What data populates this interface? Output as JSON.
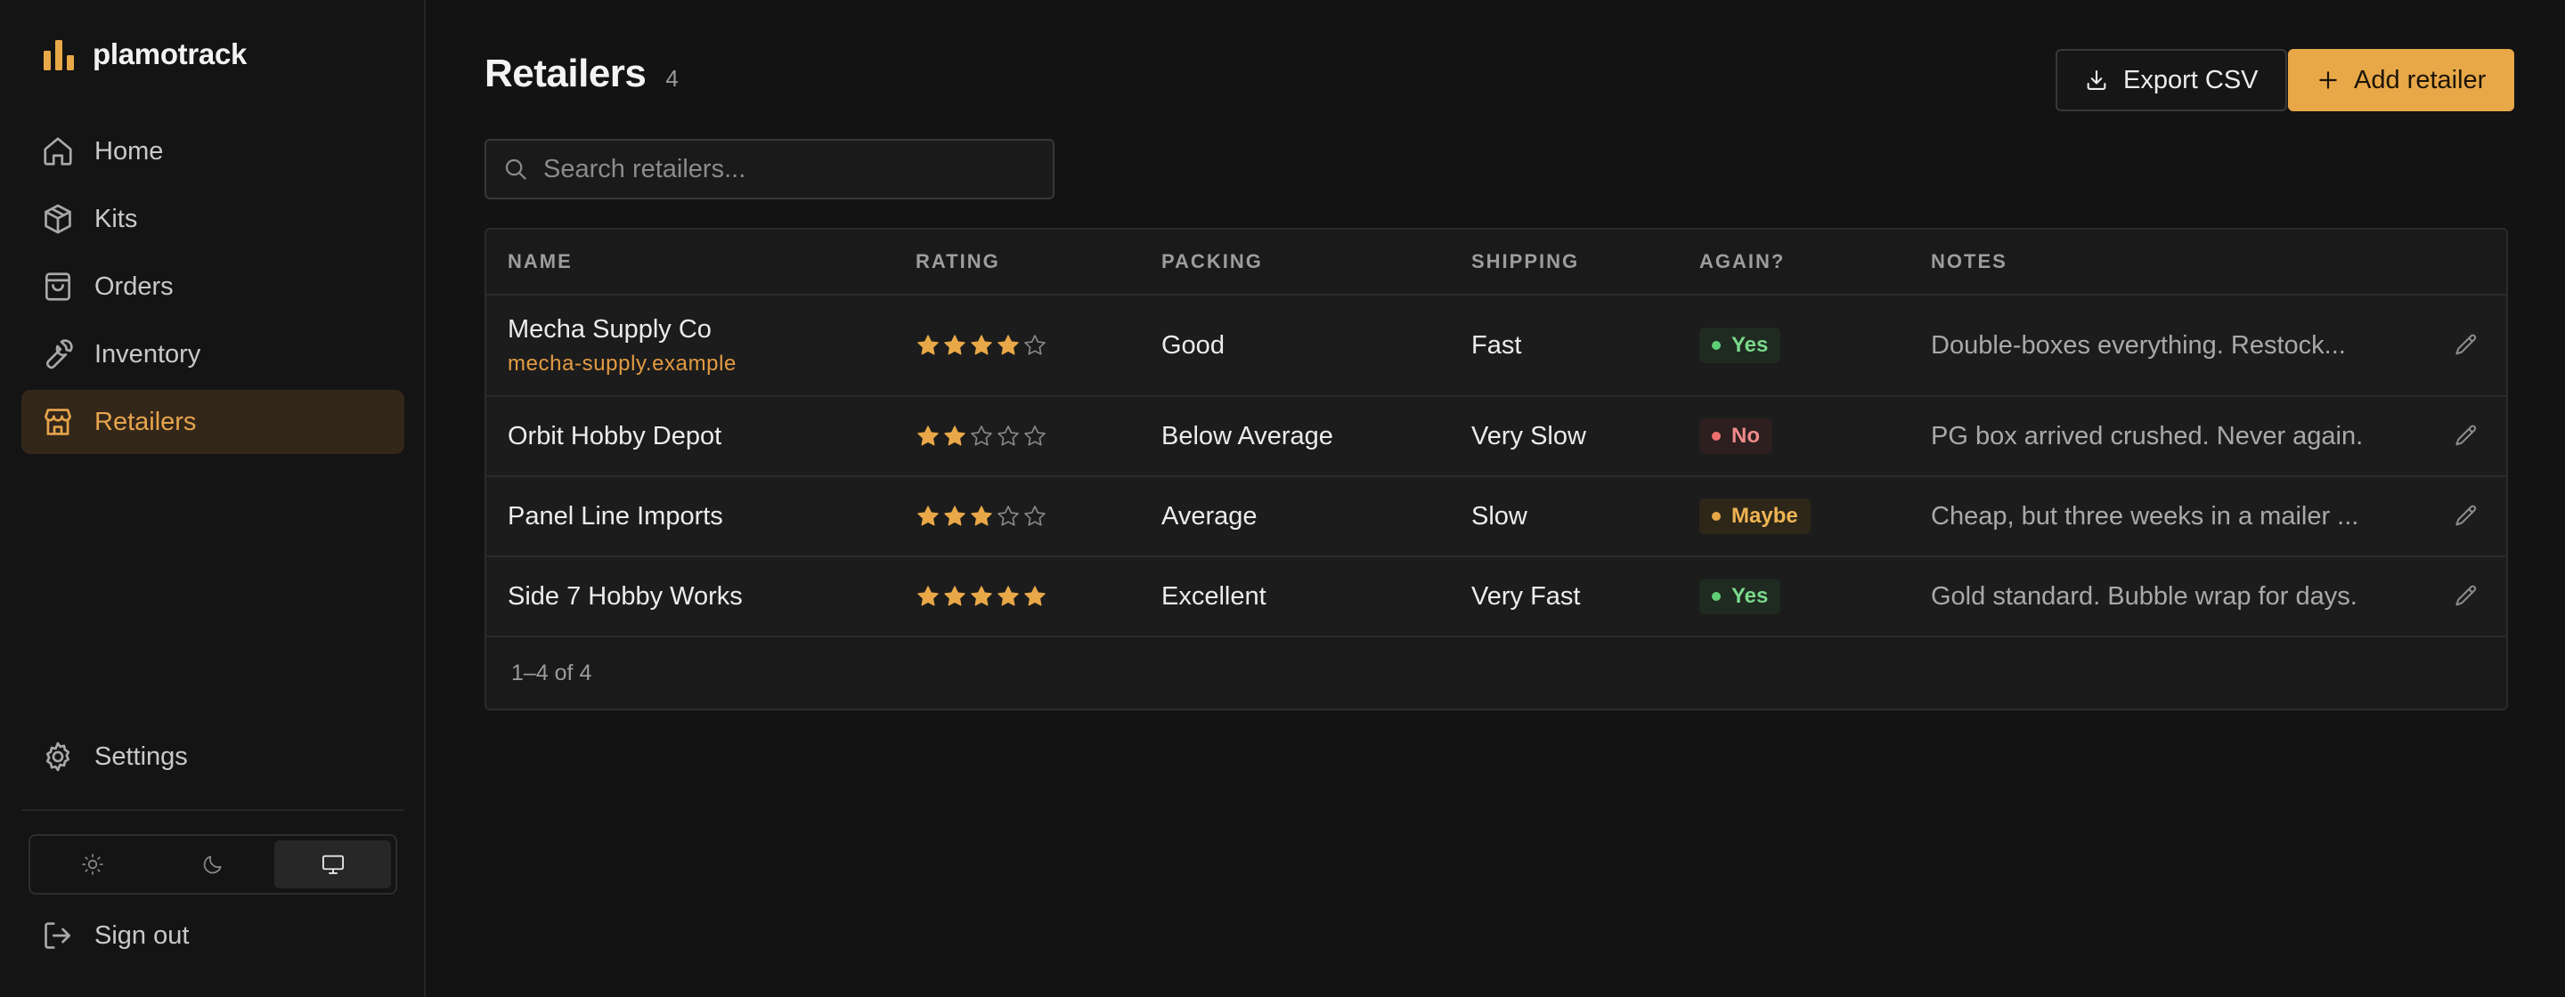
{
  "app": {
    "brand_name": "plamotrack",
    "accent_color": "#e8a848"
  },
  "sidebar": {
    "items": [
      {
        "label": "Home",
        "icon": "home-icon",
        "active": false
      },
      {
        "label": "Kits",
        "icon": "box-icon",
        "active": false
      },
      {
        "label": "Orders",
        "icon": "shopping-bag-icon",
        "active": false
      },
      {
        "label": "Inventory",
        "icon": "wrench-icon",
        "active": false
      },
      {
        "label": "Retailers",
        "icon": "store-icon",
        "active": true
      }
    ],
    "settings_label": "Settings",
    "signout_label": "Sign out",
    "theme_options": [
      {
        "name": "light",
        "icon": "sun-icon",
        "active": false
      },
      {
        "name": "dark",
        "icon": "moon-icon",
        "active": false
      },
      {
        "name": "system",
        "icon": "monitor-icon",
        "active": true
      }
    ]
  },
  "page": {
    "title": "Retailers",
    "count": "4"
  },
  "toolbar": {
    "export_label": "Export CSV",
    "add_label": "Add retailer"
  },
  "search": {
    "placeholder": "Search retailers...",
    "value": ""
  },
  "table": {
    "columns": [
      "NAME",
      "RATING",
      "PACKING",
      "SHIPPING",
      "AGAIN?",
      "NOTES"
    ],
    "rows": [
      {
        "name": "Mecha Supply Co",
        "url": "mecha-supply.example",
        "rating": 4,
        "packing": "Good",
        "shipping": "Fast",
        "again": "Yes",
        "again_status": "yes",
        "notes": "Double-boxes everything. Restock..."
      },
      {
        "name": "Orbit Hobby Depot",
        "url": "",
        "rating": 2,
        "packing": "Below Average",
        "shipping": "Very Slow",
        "again": "No",
        "again_status": "no",
        "notes": "PG box arrived crushed. Never again."
      },
      {
        "name": "Panel Line Imports",
        "url": "",
        "rating": 3,
        "packing": "Average",
        "shipping": "Slow",
        "again": "Maybe",
        "again_status": "maybe",
        "notes": "Cheap, but three weeks in a mailer ..."
      },
      {
        "name": "Side 7 Hobby Works",
        "url": "",
        "rating": 5,
        "packing": "Excellent",
        "shipping": "Very Fast",
        "again": "Yes",
        "again_status": "yes",
        "notes": "Gold standard. Bubble wrap for days."
      }
    ],
    "rating_max": 5,
    "footer": "1–4 of 4"
  }
}
